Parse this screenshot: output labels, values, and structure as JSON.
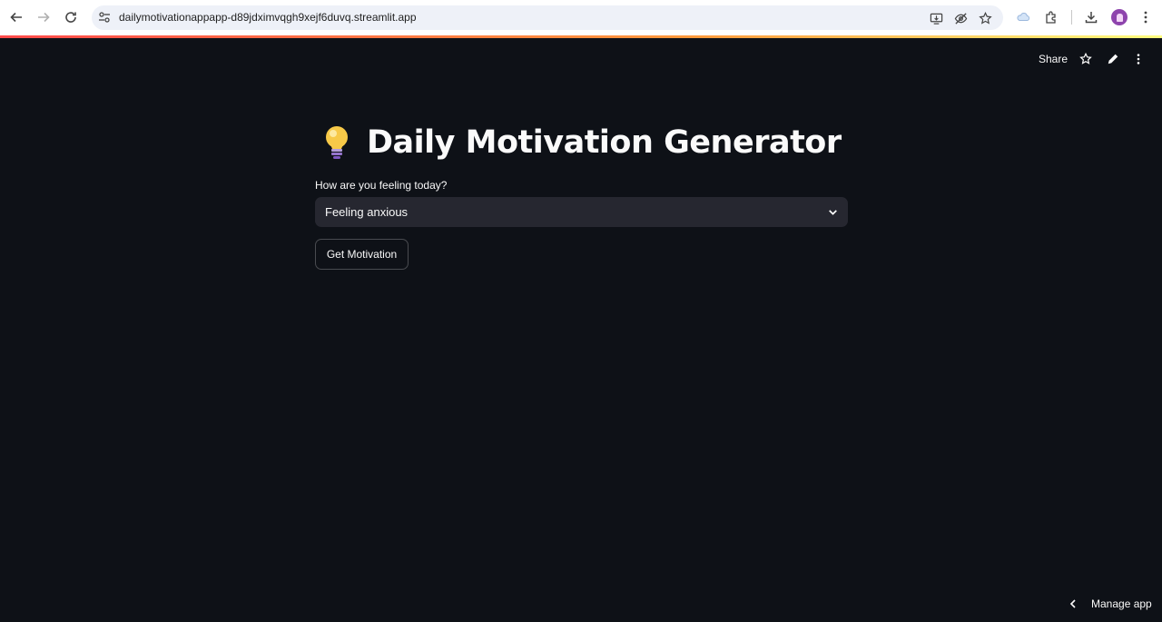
{
  "browser": {
    "url": "dailymotivationappapp-d89jdximvqgh9xejf6duvq.streamlit.app",
    "nav_icons": [
      "back-icon",
      "forward-icon",
      "reload-icon"
    ],
    "omnibox_icons": [
      "site-info-icon",
      "install-app-icon",
      "eye-off-icon",
      "bookmark-star-icon"
    ],
    "toolbar_icons": [
      "extension-puzzle-icon",
      "download-icon",
      "profile-avatar",
      "chrome-menu-icon"
    ]
  },
  "streamlit_toolbar": {
    "share_label": "Share",
    "icons": [
      "star-icon",
      "edit-pencil-icon",
      "more-vert-icon"
    ]
  },
  "main": {
    "title_icon": "lightbulb-icon",
    "title": "Daily Motivation Generator",
    "select_label": "How are you feeling today?",
    "select_value": "Feeling anxious",
    "button_label": "Get Motivation"
  },
  "footer": {
    "manage_app_label": "Manage app"
  },
  "colors": {
    "background": "#0e1117",
    "input_bg": "#262730",
    "text": "#fafafa",
    "accent": "#ff4b4b"
  }
}
